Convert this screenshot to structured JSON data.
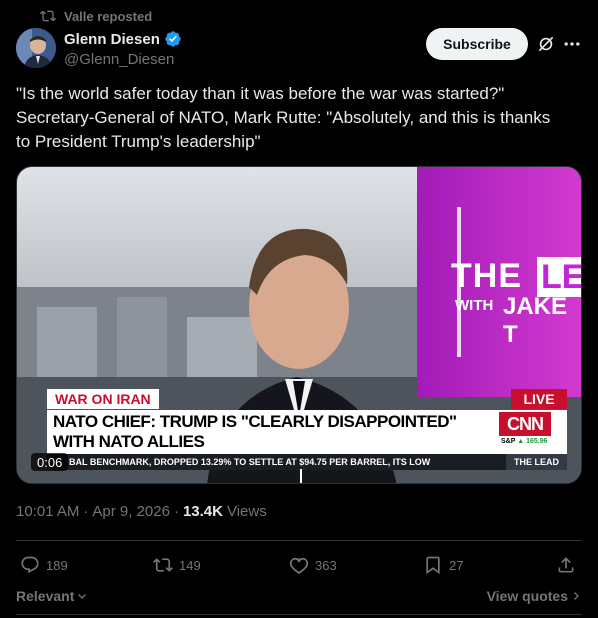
{
  "repost": {
    "label": "Valle reposted"
  },
  "author": {
    "name": "Glenn Diesen",
    "handle": "@Glenn_Diesen"
  },
  "header": {
    "subscribe_label": "Subscribe"
  },
  "tweet": {
    "text": "\"Is the world safer today than it was before the war was started?\"\nSecretary-General of NATO, Mark Rutte: \"Absolutely, and this is thanks\nto President Trump's leadership\""
  },
  "video": {
    "banner_tag": "WAR ON IRAN",
    "live": "LIVE",
    "headline": "NATO CHIEF: TRUMP IS \"CLEARLY DISAPPOINTED\" WITH NATO ALLIES",
    "network": "CNN",
    "sp_label": "S&P",
    "sp_value": "▲ 165.96",
    "ticker": "BAL BENCHMARK, DROPPED 13.29% TO SETTLE AT $94.75 PER BARREL, ITS LOW",
    "ticker_brand": "THE LEAD",
    "studio_the": "THE",
    "studio_le": "LE",
    "studio_with": "WITH",
    "studio_jake": "JAKE T",
    "timestamp": "0:06",
    "progress_fraction": 0.48
  },
  "meta": {
    "time": "10:01 AM",
    "sep1": "·",
    "date": "Apr 9, 2026",
    "sep2": "·",
    "views_count": "13.4K",
    "views_label": "Views"
  },
  "actions": {
    "replies": "189",
    "reposts": "149",
    "likes": "363",
    "bookmarks": "27"
  },
  "footer": {
    "sort_label": "Relevant",
    "view_quotes": "View quotes"
  },
  "colors": {
    "background": "#000000",
    "text": "#e7e9ea",
    "muted": "#71767b",
    "verified": "#1d9bf0",
    "cnn_red": "#c8102e"
  },
  "icons": {
    "repost": "repost-icon",
    "verified": "verified-badge-icon",
    "grok": "grok-icon",
    "more": "more-icon",
    "reply": "reply-icon",
    "retweet": "retweet-icon",
    "like": "heart-icon",
    "bookmark": "bookmark-icon",
    "share": "share-icon"
  }
}
